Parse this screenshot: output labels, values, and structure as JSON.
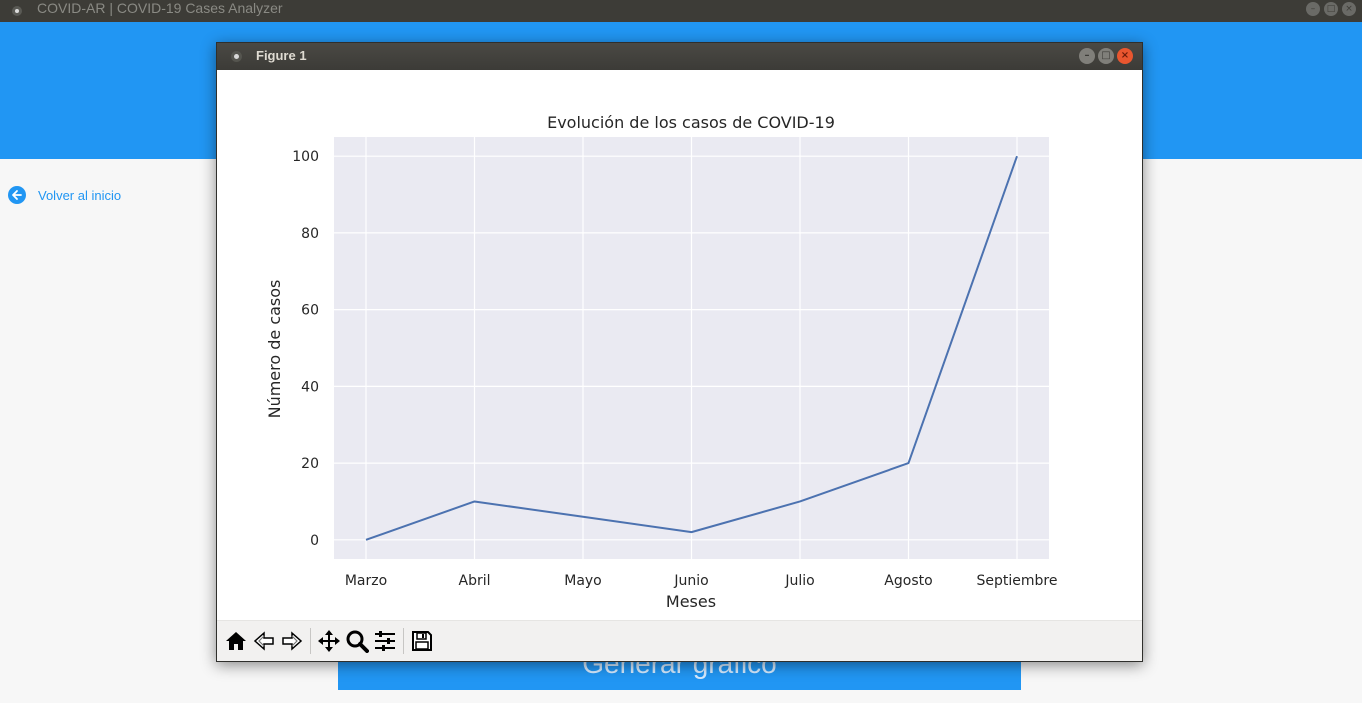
{
  "app": {
    "title": "COVID-AR | COVID-19 Cases Analyzer",
    "accent_color": "#2196f3",
    "back_link": "Volver al inicio",
    "generate_button": "Generar gráfico"
  },
  "figure_window": {
    "title": "Figure 1",
    "toolbar": [
      {
        "icon": "home-icon"
      },
      {
        "icon": "back-arrow-icon"
      },
      {
        "icon": "forward-arrow-icon"
      },
      {
        "icon": "pan-icon"
      },
      {
        "icon": "zoom-icon"
      },
      {
        "icon": "configure-subplots-icon"
      },
      {
        "icon": "save-icon"
      }
    ]
  },
  "chart_data": {
    "type": "line",
    "title": "Evolución de los casos de COVID-19",
    "xlabel": "Meses",
    "ylabel": "Número de casos",
    "categories": [
      "Marzo",
      "Abril",
      "Mayo",
      "Junio",
      "Julio",
      "Agosto",
      "Septiembre"
    ],
    "series": [
      {
        "values": [
          0,
          10,
          6,
          2,
          10,
          20,
          100
        ],
        "color": "#4c72b0"
      }
    ],
    "yticks": [
      0,
      20,
      40,
      60,
      80,
      100
    ],
    "ylim": [
      -5,
      105
    ],
    "grid": true,
    "background_color": "#eaeaf2",
    "grid_color": "#ffffff"
  }
}
